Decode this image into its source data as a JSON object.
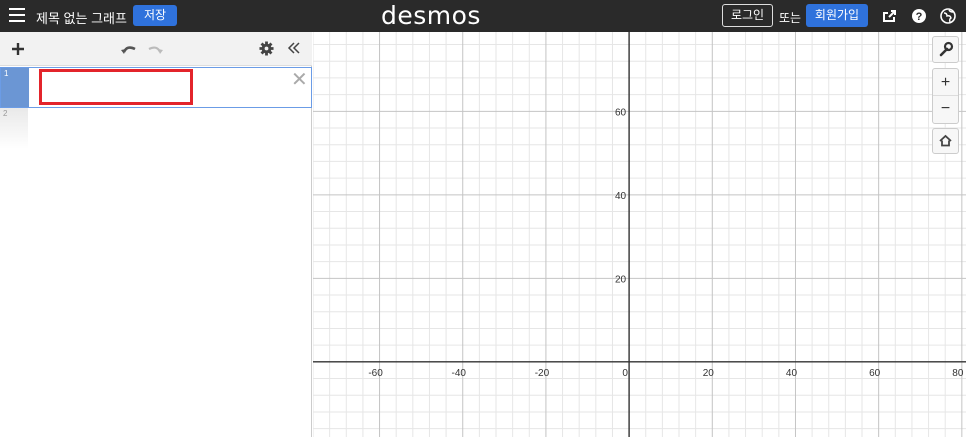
{
  "header": {
    "title": "제목 없는 그래프",
    "save_label": "저장",
    "logo": "desmos",
    "login_label": "로그인",
    "or_label": "또는",
    "signup_label": "회원가입",
    "icons": [
      "share-icon",
      "help-icon",
      "language-globe-icon"
    ]
  },
  "expressions": [
    {
      "index": "1",
      "value": ""
    },
    {
      "index": "2",
      "value": ""
    }
  ],
  "graph": {
    "x_ticks": [
      "-60",
      "-40",
      "-20",
      "0",
      "20",
      "40",
      "60",
      "80"
    ],
    "y_ticks": [
      "20",
      "40",
      "60"
    ],
    "x_tick_values": [
      -60,
      -40,
      -20,
      0,
      20,
      40,
      60,
      80
    ],
    "y_tick_values": [
      20,
      40,
      60
    ],
    "x_range": [
      -76,
      81
    ],
    "y_range": [
      -18,
      79
    ],
    "minor_step": 4,
    "major_step": 20,
    "controls": [
      "settings-wrench-icon",
      "zoom-in-icon",
      "zoom-out-icon",
      "home-icon"
    ]
  },
  "colors": {
    "header_bg": "#2a2a2a",
    "accent_blue": "#2f72dc",
    "expr_tab": "#6b96d4",
    "highlight_red": "#e3242b",
    "grid_minor": "#e6e6e6",
    "grid_major": "#c4c4c4",
    "axis": "#333333"
  }
}
